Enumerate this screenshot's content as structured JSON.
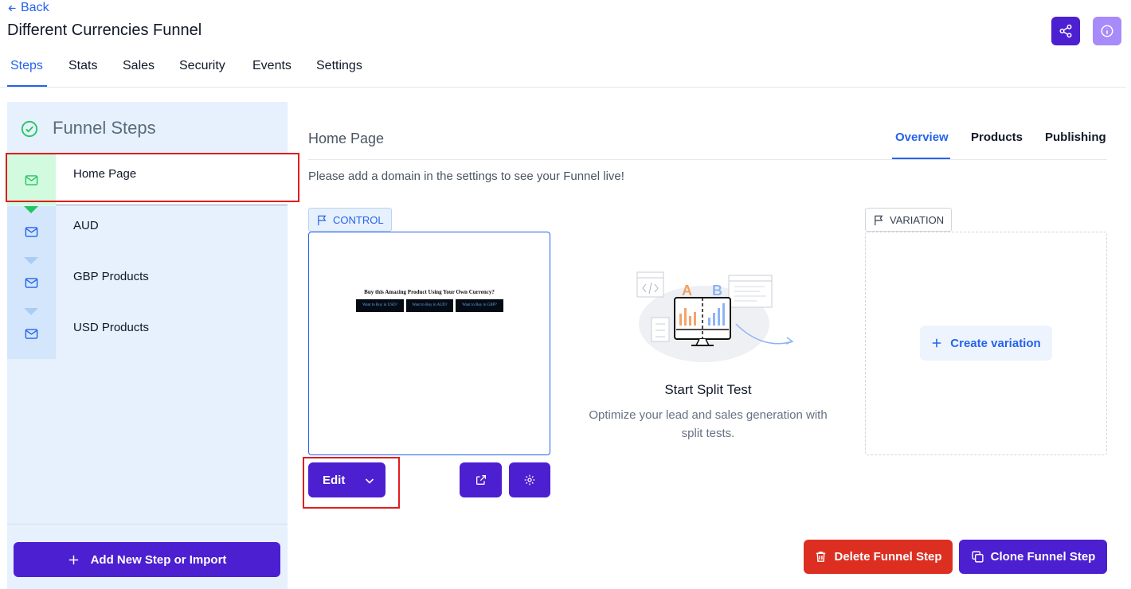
{
  "header": {
    "back_label": "Back",
    "title": "Different Currencies Funnel"
  },
  "tabs": [
    {
      "label": "Steps",
      "active": true
    },
    {
      "label": "Stats"
    },
    {
      "label": "Sales"
    },
    {
      "label": "Security"
    },
    {
      "label": "Events"
    },
    {
      "label": "Settings"
    }
  ],
  "sidebar": {
    "title": "Funnel Steps",
    "steps": [
      {
        "label": "Home Page",
        "icon": "mail-icon",
        "active": true
      },
      {
        "label": "AUD",
        "icon": "mail-icon"
      },
      {
        "label": "GBP Products",
        "icon": "mail-icon"
      },
      {
        "label": "USD Products",
        "icon": "mail-icon"
      }
    ],
    "add_button_label": "Add New Step or Import"
  },
  "main": {
    "title": "Home Page",
    "sub_tabs": [
      {
        "label": "Overview",
        "active": true
      },
      {
        "label": "Products"
      },
      {
        "label": "Publishing"
      }
    ],
    "notice": "Please add a domain in the settings to see your Funnel live!",
    "control_tag": "CONTROL",
    "variation_tag": "VARIATION",
    "preview": {
      "headline": "Buy this Amazing Product Using Your Own Currency?",
      "buttons": [
        "Want to Buy in USD?",
        "Want to Buy in AUD?",
        "Want to Buy in GBP?"
      ]
    },
    "edit_label": "Edit",
    "split_test": {
      "title": "Start Split Test",
      "description": "Optimize your lead and sales generation with split tests.",
      "illus_a": "A",
      "illus_b": "B"
    },
    "create_variation_label": "Create variation",
    "delete_label": "Delete Funnel Step",
    "clone_label": "Clone Funnel Step"
  },
  "colors": {
    "primary": "#4c1fd1",
    "link": "#2563eb",
    "danger": "#dc2f22",
    "sidebar_bg": "#e6f1fd"
  }
}
